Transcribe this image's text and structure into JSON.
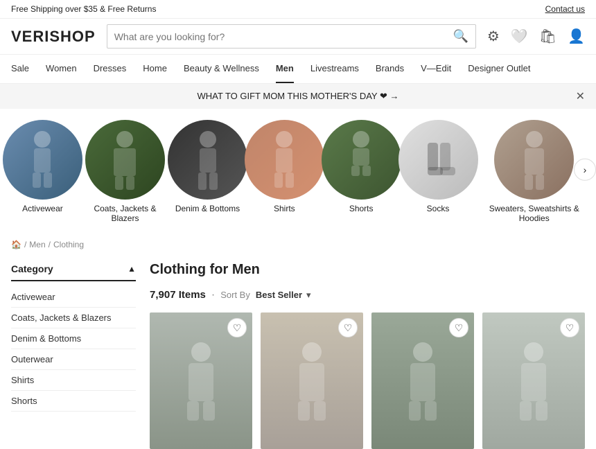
{
  "top_banner": {
    "left_text": "Free Shipping over $35 & Free Returns",
    "right_link": "Contact us"
  },
  "header": {
    "logo": "VERISHOP",
    "search_placeholder": "What are you looking for?",
    "icons": [
      "settings-icon",
      "wishlist-icon",
      "bag-icon",
      "user-icon"
    ]
  },
  "nav": {
    "items": [
      {
        "label": "Sale",
        "active": false
      },
      {
        "label": "Women",
        "active": false
      },
      {
        "label": "Dresses",
        "active": false
      },
      {
        "label": "Home",
        "active": false
      },
      {
        "label": "Beauty & Wellness",
        "active": false
      },
      {
        "label": "Men",
        "active": true
      },
      {
        "label": "Livestreams",
        "active": false
      },
      {
        "label": "Brands",
        "active": false
      },
      {
        "label": "V—Edit",
        "active": false
      },
      {
        "label": "Designer Outlet",
        "active": false
      }
    ]
  },
  "promo": {
    "text": "WHAT TO GIFT MOM THIS MOTHER'S DAY ❤ →"
  },
  "breadcrumb": {
    "home_icon": "🏠",
    "items": [
      "Men",
      "Clothing"
    ]
  },
  "categories": [
    {
      "id": "activewear",
      "label": "Activewear",
      "color_class": "cat-activewear"
    },
    {
      "id": "coats",
      "label": "Coats, Jackets &\nBlazers",
      "label_line1": "Coats, Jackets &",
      "label_line2": "Blazers",
      "color_class": "cat-coats"
    },
    {
      "id": "denim",
      "label": "Denim & Bottoms",
      "color_class": "cat-denim"
    },
    {
      "id": "shirts",
      "label": "Shirts",
      "color_class": "cat-shirts"
    },
    {
      "id": "shorts",
      "label": "Shorts",
      "color_class": "cat-shorts"
    },
    {
      "id": "socks",
      "label": "Socks",
      "color_class": "cat-socks"
    },
    {
      "id": "sweaters",
      "label": "Sweaters,\nSweatshirts &\nHoodies",
      "label_line1": "Sweaters,",
      "label_line2": "Sweatshirts &",
      "label_line3": "Hoodies",
      "color_class": "cat-sweaters"
    }
  ],
  "page_heading": "Clothing for Men",
  "product_count": "7,907 Items",
  "sort": {
    "label": "Sort By",
    "value": "Best Seller",
    "arrow": "▾"
  },
  "sidebar": {
    "title": "Category",
    "collapse_icon": "▲",
    "items": [
      "Activewear",
      "Coats, Jackets & Blazers",
      "Denim & Bottoms",
      "Outerwear",
      "Shirts",
      "Shorts"
    ]
  },
  "products": [
    {
      "id": 1,
      "color_class": "prod1"
    },
    {
      "id": 2,
      "color_class": "prod2"
    },
    {
      "id": 3,
      "color_class": "prod3"
    },
    {
      "id": 4,
      "color_class": "prod4"
    }
  ]
}
